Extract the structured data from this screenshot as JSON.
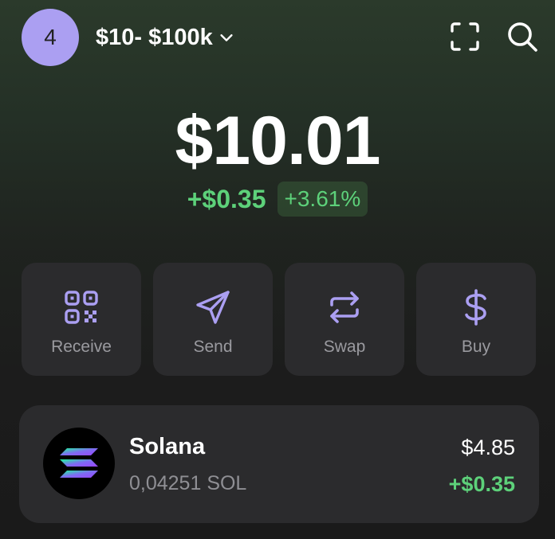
{
  "header": {
    "avatar_text": "4",
    "account_label": "$10- $100k",
    "icons": [
      "chevron-down-icon",
      "scan-icon",
      "search-icon"
    ]
  },
  "portfolio": {
    "balance": "$10.01",
    "change_abs": "+$0.35",
    "change_pct": "+3.61%"
  },
  "actions": [
    {
      "label": "Receive",
      "icon": "qr-code-icon"
    },
    {
      "label": "Send",
      "icon": "send-icon"
    },
    {
      "label": "Swap",
      "icon": "swap-icon"
    },
    {
      "label": "Buy",
      "icon": "dollar-icon"
    }
  ],
  "tokens": [
    {
      "name": "Solana",
      "amount": "0,04251 SOL",
      "value": "$4.85",
      "change": "+$0.35"
    }
  ],
  "colors": {
    "accent": "#ab9ff2",
    "positive": "#5dd17a",
    "card": "#2b2b2d",
    "muted_text": "#9a9a9f"
  }
}
